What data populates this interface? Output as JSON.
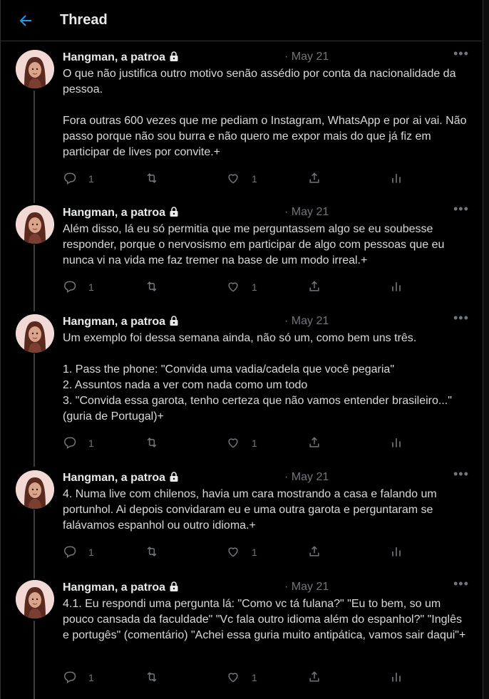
{
  "header": {
    "title": "Thread",
    "back_icon": "arrow-left-icon"
  },
  "colors": {
    "accent": "#1d9bf0",
    "muted": "#71767b",
    "text": "#d9d9d9",
    "background": "#000000"
  },
  "tweets": [
    {
      "author": "Hangman, a patroa",
      "locked": true,
      "date": "· May 21",
      "text": "O que não justifica outro motivo senão assédio por conta da nacionalidade da pessoa.\n\nFora outras 600 vezes que me pediam o Instagram, WhatsApp e por ai vai. Não passo porque não sou burra e não quero me expor mais do que já fiz em participar de lives por convite.+",
      "replies": "1",
      "likes": "1"
    },
    {
      "author": "Hangman, a patroa",
      "locked": true,
      "date": "· May 21",
      "text": "Além disso, lá eu só permitia que me perguntassem algo se eu soubesse responder, porque o nervosismo em participar de algo com pessoas que eu nunca vi na vida me faz tremer na base de um modo irreal.+",
      "replies": "1",
      "likes": "1"
    },
    {
      "author": "Hangman, a patroa",
      "locked": true,
      "date": "· May 21",
      "text": "Um exemplo foi dessa semana ainda, não só um, como bem uns três.\n\n1. Pass the phone: \"Convida uma vadia/cadela que você pegaria\"\n2. Assuntos nada a ver com nada como um todo\n3. \"Convida essa garota, tenho certeza que não vamos entender brasileiro...\" (guria de Portugal)+",
      "replies": "1",
      "likes": "1"
    },
    {
      "author": "Hangman, a patroa",
      "locked": true,
      "date": "· May 21",
      "text": "4. Numa live com chilenos, havia um cara mostrando a casa e falando um portunhol. Ai depois convidaram eu e uma outra garota e perguntaram se falávamos espanhol ou outro idioma.+",
      "replies": "1",
      "likes": "1"
    },
    {
      "author": "Hangman, a patroa",
      "locked": true,
      "date": "· May 21",
      "text": "4.1. Eu respondi uma pergunta lá: \"Como vc tá fulana?\" \"Eu to bem, so um pouco cansada da faculdade\" \"Vc fala outro idioma além do espanhol?\" \"Inglês e portugês\" (comentário) \"Achei essa guria muito antipática, vamos sair daqui\"+",
      "replies": "1",
      "likes": "1"
    }
  ]
}
